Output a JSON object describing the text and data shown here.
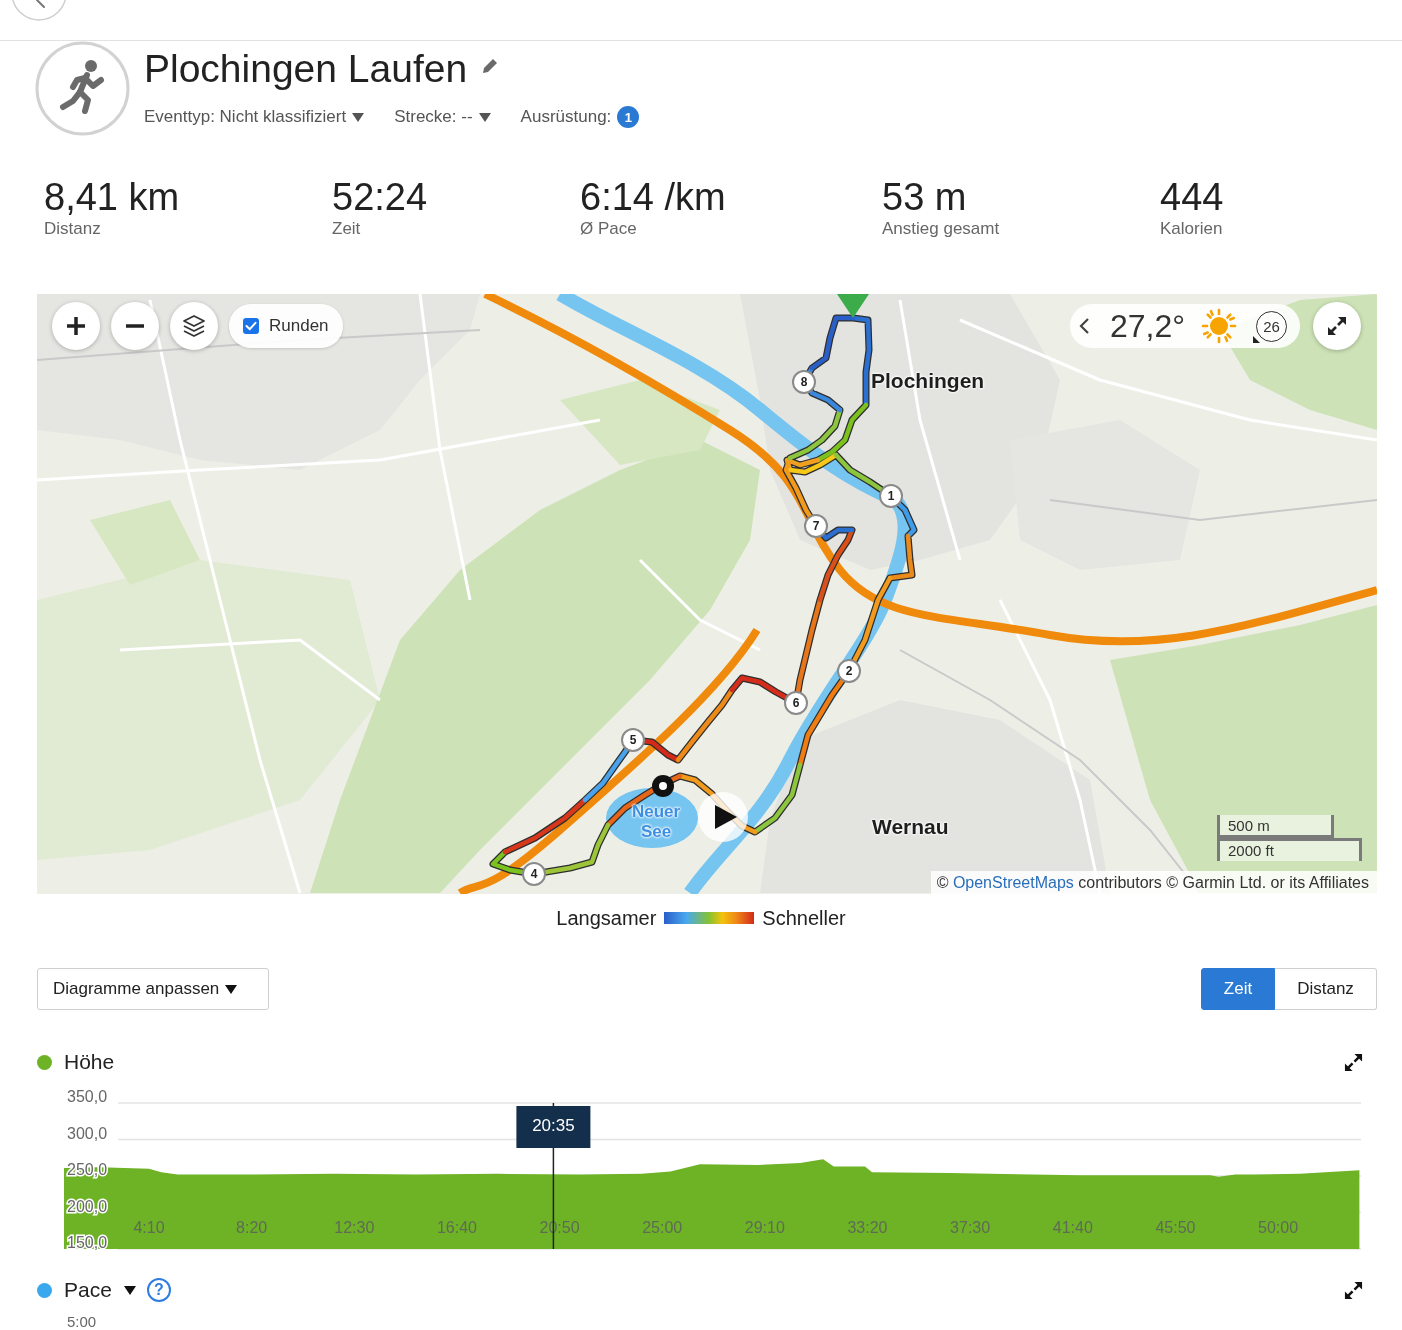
{
  "header": {
    "title": "Plochingen Laufen",
    "meta": [
      {
        "kind": "dropdown",
        "text": "Eventtyp: Nicht klassifiziert"
      },
      {
        "kind": "dropdown",
        "text": "Strecke: --"
      },
      {
        "kind": "count",
        "text": "Ausrüstung:",
        "count": "1"
      }
    ]
  },
  "stats": [
    {
      "value": "8,41 km",
      "label": "Distanz"
    },
    {
      "value": "52:24",
      "label": "Zeit"
    },
    {
      "value": "6:14 /km",
      "label": "Ø Pace"
    },
    {
      "value": "53 m",
      "label": "Anstieg gesamt"
    },
    {
      "value": "444",
      "label": "Kalorien"
    }
  ],
  "map": {
    "laps_toggle": {
      "label": "Runden",
      "checked": true
    },
    "weather": {
      "temperature": "27,2°",
      "wind_speed": "26"
    },
    "place_labels": [
      {
        "text": "Plochingen",
        "kind": "town"
      },
      {
        "text": "Wernau",
        "kind": "town"
      },
      {
        "text": "Neuer See",
        "kind": "water"
      }
    ],
    "lap_markers": [
      {
        "label": "1"
      },
      {
        "label": "2"
      },
      {
        "label": "4"
      },
      {
        "label": "5"
      },
      {
        "label": "6"
      },
      {
        "label": "7"
      },
      {
        "label": "8"
      }
    ],
    "scale": [
      "500 m",
      "2000 ft"
    ],
    "attribution": {
      "prefix": "©",
      "link": "OpenStreetMaps",
      "suffix": "contributors © Garmin Ltd. or its Affiliates"
    }
  },
  "legend": {
    "slow": "Langsamer",
    "fast": "Schneller"
  },
  "chart_controls": {
    "customize": "Diagramme anpassen",
    "axis_modes": [
      {
        "label": "Zeit",
        "selected": true
      },
      {
        "label": "Distanz",
        "selected": false
      }
    ]
  },
  "charts": [
    {
      "menu": false,
      "tooltip": "20:35",
      "chart_data": {
        "type": "area",
        "x": [
          43,
          130,
          250,
          280,
          320,
          500,
          700,
          900,
          1100,
          1300,
          1450,
          1520,
          1592,
          1733,
          1836,
          1892,
          1918,
          1994,
          2011,
          2201,
          2518,
          2835,
          2855,
          2896,
          2941,
          3053,
          3198
        ],
        "series": [
          {
            "name": "Höhe",
            "color": "#6db325",
            "values": [
              261,
              262,
              260,
              255,
              252,
              252,
              253,
              252,
              253,
              252,
              253,
              256,
              266,
              265,
              268,
              273,
              263,
              263,
              255,
              254,
              251,
              251,
              249,
              252,
              252,
              253,
              258
            ]
          }
        ],
        "xlim": [
          43,
          3202
        ],
        "ylim": [
          150,
          350
        ],
        "grid": true,
        "yticks": [
          {
            "value": 150,
            "label": "150,0"
          },
          {
            "value": 200,
            "label": "200,0"
          },
          {
            "value": 250,
            "label": "250,0"
          },
          {
            "value": 300,
            "label": "300,0"
          },
          {
            "value": 350,
            "label": "350,0"
          }
        ],
        "xticks": [
          {
            "value": 250,
            "label": "4:10"
          },
          {
            "value": 500,
            "label": "8:20"
          },
          {
            "value": 750,
            "label": "12:30"
          },
          {
            "value": 1000,
            "label": "16:40"
          },
          {
            "value": 1250,
            "label": "20:50"
          },
          {
            "value": 1500,
            "label": "25:00"
          },
          {
            "value": 1750,
            "label": "29:10"
          },
          {
            "value": 2000,
            "label": "33:20"
          },
          {
            "value": 2250,
            "label": "37:30"
          },
          {
            "value": 2500,
            "label": "41:40"
          },
          {
            "value": 2750,
            "label": "45:50"
          },
          {
            "value": 3000,
            "label": "50:00"
          }
        ],
        "ref_lines": [
          {
            "axis": "x",
            "value": 1235
          }
        ]
      }
    },
    {
      "title": "Pace",
      "color": "#3aa8ee",
      "menu": true,
      "help": "?",
      "axis_labels": [
        "5:00"
      ]
    }
  ]
}
